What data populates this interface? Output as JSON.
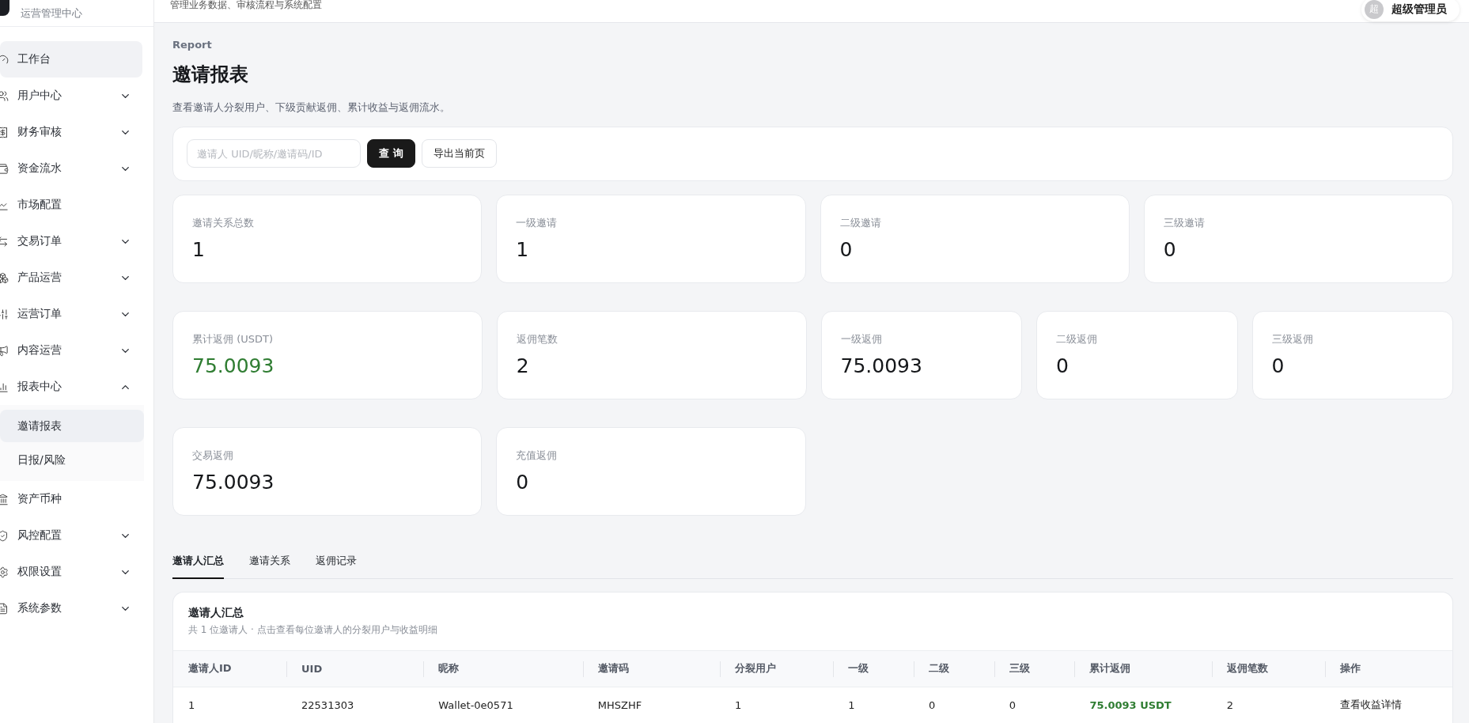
{
  "sidebar": {
    "subtitle": "运营管理中心",
    "items": [
      {
        "label": "工作台",
        "hovered": true
      },
      {
        "label": "用户中心",
        "expanded": false
      },
      {
        "label": "财务审核",
        "expanded": false
      },
      {
        "label": "资金流水",
        "expanded": false
      },
      {
        "label": "市场配置"
      },
      {
        "label": "交易订单",
        "expanded": false
      },
      {
        "label": "产品运营",
        "expanded": false
      },
      {
        "label": "运营订单",
        "expanded": false
      },
      {
        "label": "内容运营",
        "expanded": false
      },
      {
        "label": "报表中心",
        "expanded": true,
        "children": [
          {
            "label": "邀请报表",
            "selected": true
          },
          {
            "label": "日报/风险",
            "selected": false
          }
        ]
      },
      {
        "label": "资产币种"
      },
      {
        "label": "风控配置",
        "expanded": false
      },
      {
        "label": "权限设置",
        "expanded": false
      },
      {
        "label": "系统参数",
        "expanded": false
      }
    ]
  },
  "header": {
    "subtitle": "管理业务数据、审核流程与系统配置",
    "user": {
      "avatar": "超",
      "name": "超级管理员"
    }
  },
  "page": {
    "eyebrow": "Report",
    "title": "邀请报表",
    "description": "查看邀请人分裂用户、下级贡献返佣、累计收益与返佣流水。"
  },
  "filter": {
    "placeholder": "邀请人 UID/昵称/邀请码/ID",
    "buttons": [
      {
        "label": "查 询",
        "kind": "primary"
      },
      {
        "label": "导出当前页",
        "kind": "secondary"
      }
    ]
  },
  "stat_rows": [
    [
      {
        "label": "邀请关系总数",
        "value": "1",
        "kind": "plain"
      },
      {
        "label": "一级邀请",
        "value": "1",
        "kind": "plain"
      },
      {
        "label": "二级邀请",
        "value": "0",
        "kind": "plain"
      },
      {
        "label": "三级邀请",
        "value": "0",
        "kind": "plain"
      }
    ],
    [
      {
        "label": "累计返佣 (USDT)",
        "value": "75.0093",
        "kind": "accent"
      },
      {
        "label": "返佣笔数",
        "value": "2",
        "kind": "plain"
      },
      {
        "label": "一级返佣",
        "value": "75.0093",
        "kind": "plain"
      },
      {
        "label": "二级返佣",
        "value": "0",
        "kind": "plain"
      },
      {
        "label": "三级返佣",
        "value": "0",
        "kind": "plain"
      }
    ],
    [
      {
        "label": "交易返佣",
        "value": "75.0093",
        "kind": "plain"
      },
      {
        "label": "充值返佣",
        "value": "0",
        "kind": "plain"
      }
    ]
  ],
  "tabs": [
    {
      "label": "邀请人汇总",
      "selected": true
    },
    {
      "label": "邀请关系",
      "selected": false
    },
    {
      "label": "返佣记录",
      "selected": false
    }
  ],
  "table": {
    "title": "邀请人汇总",
    "subtitle": "共 1 位邀请人 · 点击查看每位邀请人的分裂用户与收益明细",
    "columns": [
      "邀请人ID",
      "UID",
      "昵称",
      "邀请码",
      "分裂用户",
      "一级",
      "二级",
      "三级",
      "累计返佣",
      "返佣笔数",
      "操作"
    ],
    "rows": [
      {
        "cells": [
          "1",
          "22531303",
          "Wallet-0e0571",
          "MHSZHF",
          "1",
          "1",
          "0",
          "0",
          "75.0093 USDT",
          "2",
          "查看收益详情"
        ]
      }
    ]
  }
}
